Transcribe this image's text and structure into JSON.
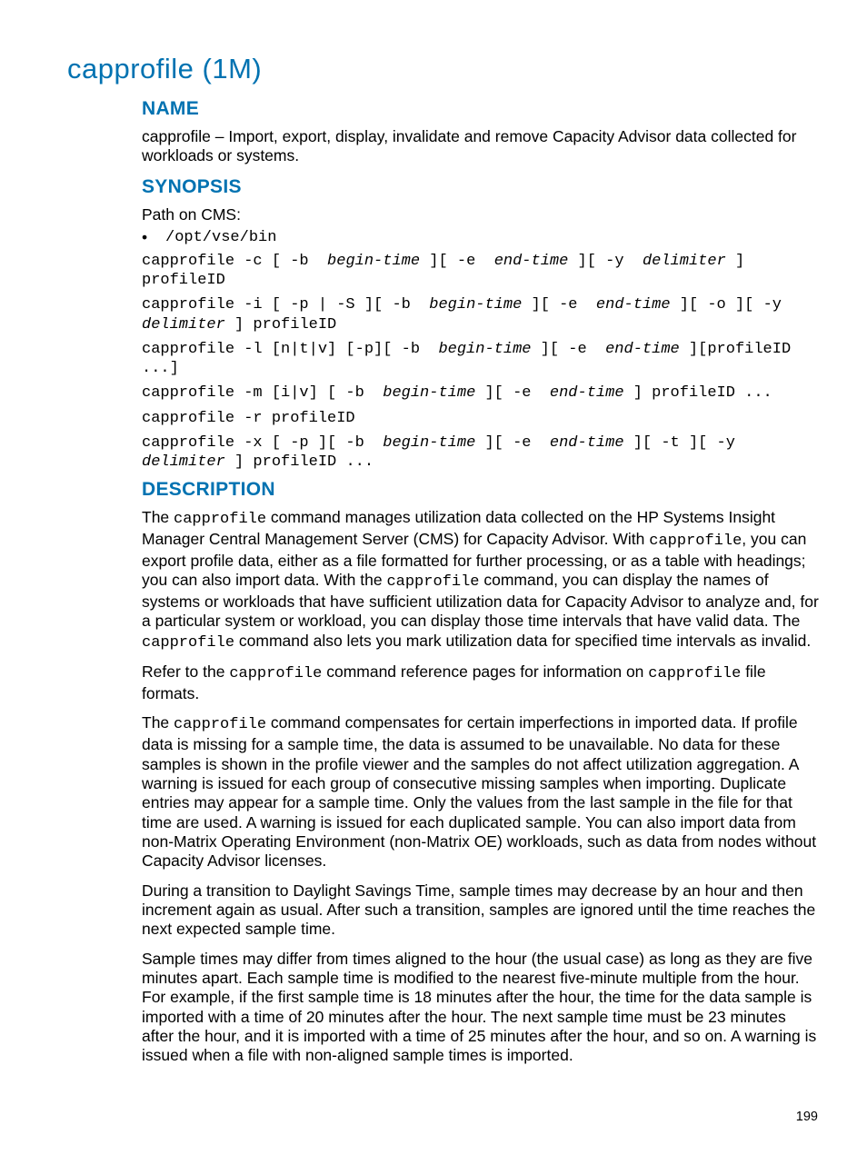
{
  "page_title": "capprofile (1M)",
  "page_number": "199",
  "sections": {
    "name": {
      "heading": "NAME",
      "text": "capprofile – Import, export, display, invalidate and remove Capacity Advisor data collected for workloads or systems."
    },
    "synopsis": {
      "heading": "SYNOPSIS",
      "path_label": "Path on CMS:",
      "path_value": "/opt/vse/bin",
      "lines_html": [
        "capprofile -c [ -b  <span class=\"italic\">begin-time</span> ][ -e  <span class=\"italic\">end-time</span> ][ -y  <span class=\"italic\">delimiter</span> ] profileID",
        "capprofile -i [ -p | -S ][ -b  <span class=\"italic\">begin-time</span> ][ -e  <span class=\"italic\">end-time</span> ][ -o ][ -y  <span class=\"italic\">delimiter</span> ] profileID",
        "capprofile -l [n|t|v] [-p][ -b  <span class=\"italic\">begin-time</span> ][ -e  <span class=\"italic\">end-time</span> ][profileID ...]",
        "capprofile -m [i|v] [ -b  <span class=\"italic\">begin-time</span> ][ -e  <span class=\"italic\">end-time</span> ] profileID ...",
        "capprofile -r profileID",
        "capprofile -x [ -p ][ -b  <span class=\"italic\">begin-time</span> ][ -e  <span class=\"italic\">end-time</span> ][ -t ][ -y  <span class=\"italic\">delimiter</span> ] profileID ..."
      ]
    },
    "description": {
      "heading": "DESCRIPTION",
      "paragraphs_html": [
        "The <span class=\"mono\">capprofile</span> command manages utilization data collected on the HP Systems Insight Manager Central Management Server (CMS) for Capacity Advisor. With <span class=\"mono\">capprofile</span>, you can export profile data, either as a file formatted for further processing, or as a table with headings; you can also import data. With the <span class=\"mono\">capprofile</span> command, you can display the names of systems or workloads that have sufficient utilization data for Capacity Advisor to analyze and, for a particular system or workload, you can display those time intervals that have valid data. The <span class=\"mono\">capprofile</span> command also lets you mark utilization data for specified time intervals as invalid.",
        "Refer to the <span class=\"mono\">capprofile</span> command reference pages for information on <span class=\"mono\">capprofile</span> file formats.",
        "The <span class=\"mono\">capprofile</span> command compensates for certain imperfections in imported data. If profile data is missing for a sample time, the data is assumed to be unavailable. No data for these samples is shown in the profile viewer and the samples do not affect utilization aggregation. A warning is issued for each group of consecutive missing samples when importing. Duplicate entries may appear for a sample time. Only the values from the last sample in the file for that time are used. A warning is issued for each duplicated sample. You can also import data from non-Matrix Operating Environment (non-Matrix OE) workloads, such as data from nodes without Capacity Advisor licenses.",
        "During a transition to Daylight Savings Time, sample times may decrease by an hour and then increment again as usual. After such a transition, samples are ignored until the time reaches the next expected sample time.",
        "Sample times may differ from times aligned to the hour (the usual case) as long as they are five minutes apart. Each sample time is modified to the nearest five-minute multiple from the hour. For example, if the first sample time is 18 minutes after the hour, the time for the data sample is imported with a time of 20 minutes after the hour. The next sample time must be 23 minutes after the hour, and it is imported with a time of 25 minutes after the hour, and so on. A warning is issued when a file with non-aligned sample times is imported."
      ]
    }
  }
}
